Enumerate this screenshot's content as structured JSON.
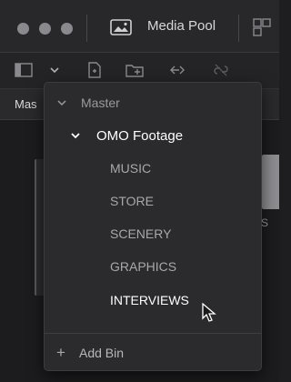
{
  "window": {
    "title": "Media Pool",
    "title_icon": "media-pool-icon",
    "right_icon": "panel-layout-icon"
  },
  "toolbar": {
    "icons": [
      "sidebar-toggle-icon",
      "chevron-down-icon",
      "new-file-icon",
      "new-bin-icon",
      "relink-icon",
      "unlink-icon"
    ]
  },
  "bin_header": {
    "label": "Mas"
  },
  "content": {
    "right_partial_text": "S"
  },
  "dropdown": {
    "root": "Master",
    "folder": "OMO Footage",
    "bins": [
      "MUSIC",
      "STORE",
      "SCENERY",
      "GRAPHICS",
      "INTERVIEWS"
    ],
    "active_bin": "INTERVIEWS",
    "add_symbol": "+",
    "add_label": "Add Bin"
  },
  "colors": {
    "background": "#1e1e20",
    "menu": "#2b2b2e",
    "text": "#cfcfd2",
    "active_text": "#ffffff"
  }
}
